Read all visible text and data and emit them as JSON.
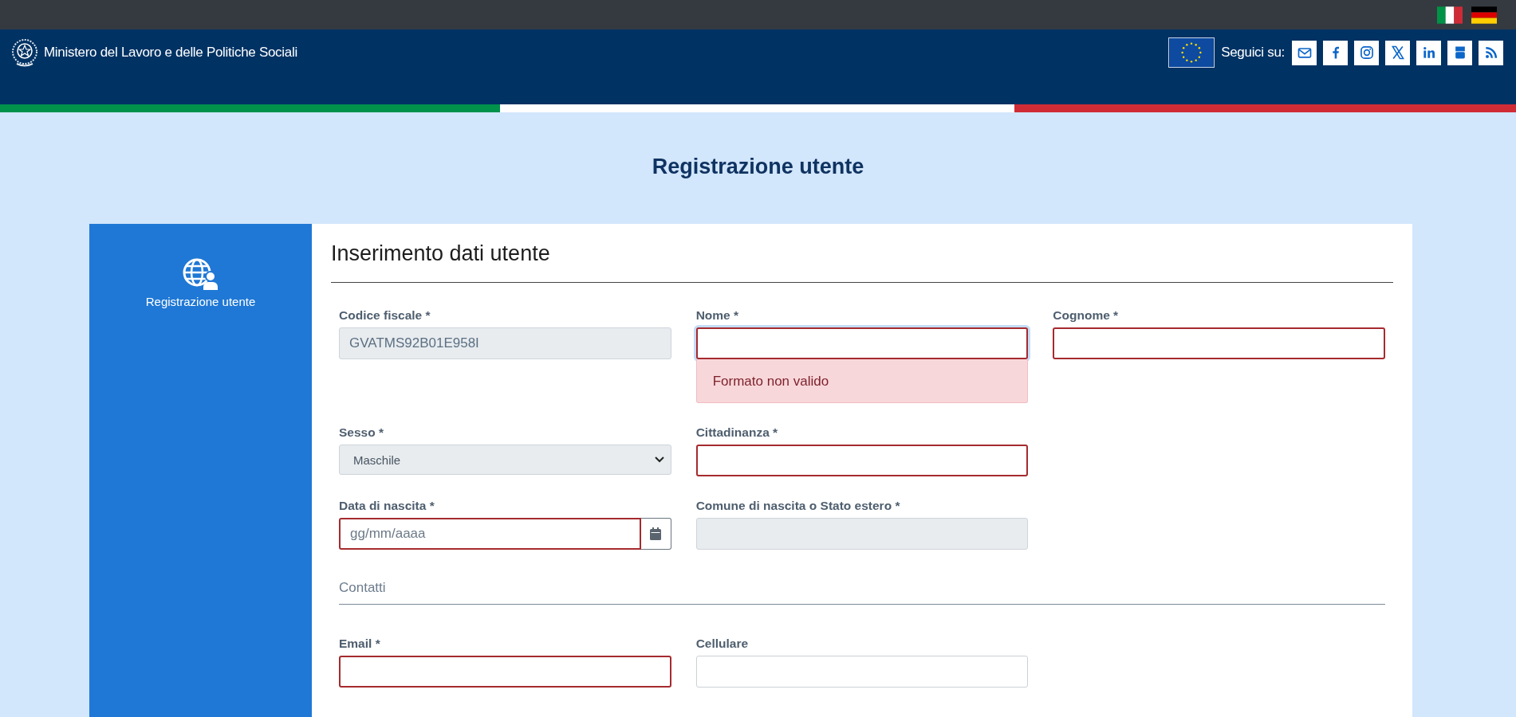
{
  "header": {
    "title": "Ministero del Lavoro e delle Politiche Sociali",
    "follow_label": "Seguici su:"
  },
  "page_title": "Registrazione utente",
  "sidebar": {
    "items": [
      {
        "label": "Registrazione utente"
      }
    ]
  },
  "form": {
    "heading": "Inserimento dati utente",
    "groups": [
      {
        "rows": [
          [
            {
              "label": "Codice fiscale *",
              "kind": "text",
              "value": "GVATMS92B01E958I",
              "disabled": true,
              "invalid": false,
              "focused": false
            },
            {
              "label": "Nome *",
              "kind": "text",
              "disabled": false,
              "invalid": true,
              "focused": true,
              "error": "Formato non valido"
            },
            {
              "label": "Cognome *",
              "kind": "text",
              "disabled": false,
              "invalid": true,
              "focused": false
            }
          ],
          [
            {
              "label": "Sesso *",
              "kind": "select",
              "value": "Maschile",
              "disabled": true,
              "invalid": false,
              "focused": false
            },
            {
              "label": "Cittadinanza *",
              "kind": "text",
              "disabled": false,
              "invalid": true,
              "focused": false
            }
          ],
          [
            {
              "label": "Data di nascita *",
              "kind": "date",
              "placeholder": "gg/mm/aaaa",
              "disabled": false,
              "invalid": true,
              "focused": false
            },
            {
              "label": "Comune di nascita o Stato estero *",
              "kind": "text",
              "disabled": true,
              "invalid": false,
              "focused": false
            }
          ]
        ]
      },
      {
        "title": "Contatti",
        "rows": [
          [
            {
              "label": "Email *",
              "kind": "text",
              "disabled": false,
              "invalid": true,
              "focused": false
            },
            {
              "label": "Cellulare",
              "kind": "text",
              "disabled": false,
              "invalid": false,
              "focused": false
            }
          ]
        ]
      }
    ]
  }
}
